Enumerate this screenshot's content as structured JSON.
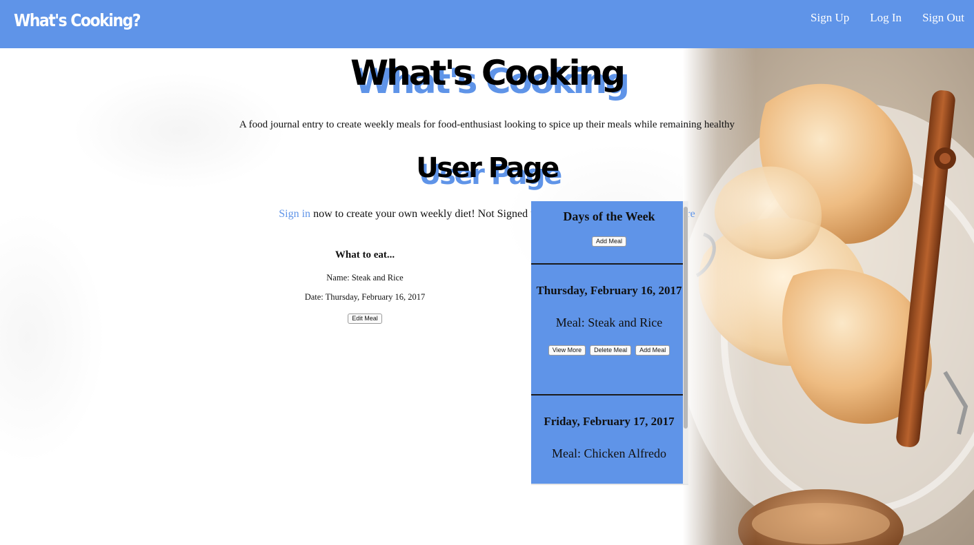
{
  "navbar": {
    "brand": "What's Cooking?",
    "links": [
      "Sign Up",
      "Log In",
      "Sign Out"
    ]
  },
  "hero": {
    "title": "What's Cooking",
    "subtitle": "A food journal entry to create weekly meals for food-enthusiast looking to spice up their meals while remaining healthy"
  },
  "user_section": {
    "title": "User Page",
    "signin_link": "Sign in",
    "signin_text": " now to create your own weekly diet! Not Signed up yet? Sign up now by clicking ",
    "here_link": "here"
  },
  "what_to_eat": {
    "title": "What to eat...",
    "name_line": "Name: Steak and Rice",
    "date_line": "Date: Thursday, February 16, 2017",
    "edit_button": "Edit Meal"
  },
  "days_panel": {
    "title": "Days of the Week",
    "add_button": "Add Meal",
    "days": [
      {
        "date": "Thursday, February 16, 2017",
        "meal": "Meal: Steak and Rice",
        "buttons": [
          "View More",
          "Delete Meal",
          "Add Meal"
        ]
      },
      {
        "date": "Friday, February 17, 2017",
        "meal": "Meal: Chicken Alfredo"
      }
    ]
  },
  "colors": {
    "accent": "#5f94e8",
    "text": "#111111",
    "divider": "#1a1a1a"
  },
  "icons": {
    "background": "food-photo-croissants-cinnamon"
  }
}
